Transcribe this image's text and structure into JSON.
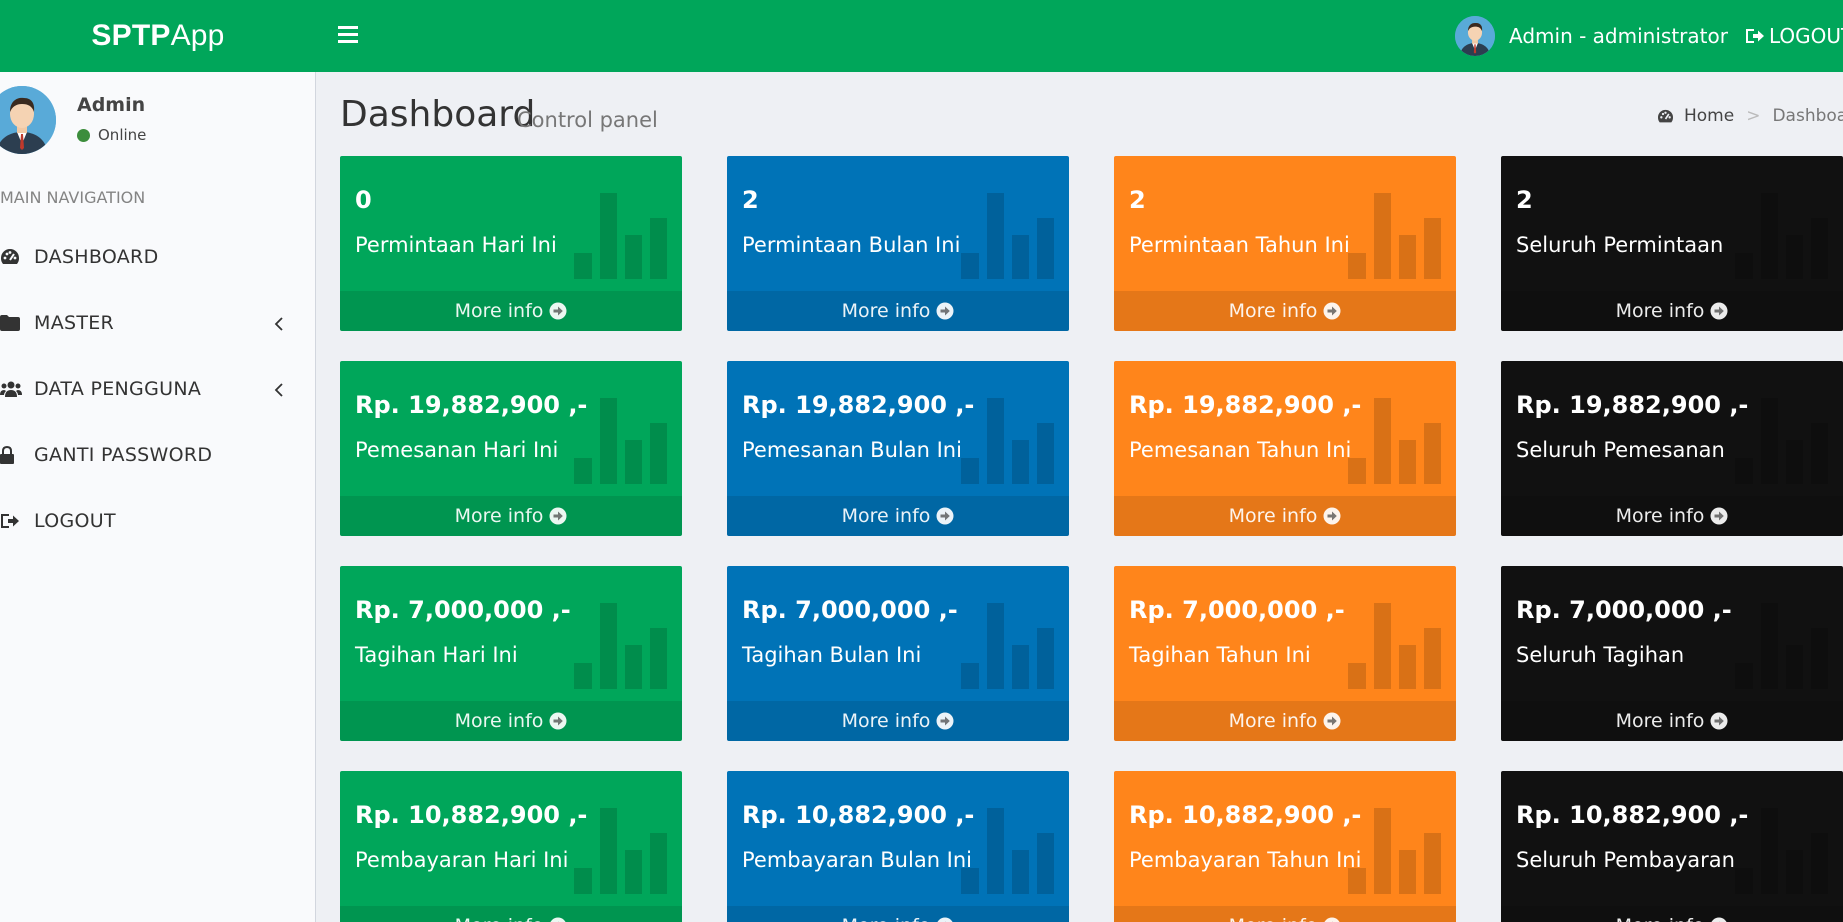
{
  "header": {
    "logo_bold": "SPTP",
    "logo_light": "App",
    "user_label": "Admin - administrator",
    "logout_label": "LOGOUT"
  },
  "sidebar": {
    "user_name": "Admin",
    "user_status": "Online",
    "nav_header": "MAIN NAVIGATION",
    "items": [
      {
        "label": "DASHBOARD",
        "icon": "dashboard-icon"
      },
      {
        "label": "MASTER",
        "icon": "folder-icon",
        "has_submenu": true
      },
      {
        "label": "DATA PENGGUNA",
        "icon": "users-icon",
        "has_submenu": true
      },
      {
        "label": "GANTI PASSWORD",
        "icon": "lock-icon"
      },
      {
        "label": "LOGOUT",
        "icon": "sign-out-icon"
      }
    ]
  },
  "content_header": {
    "title": "Dashboard",
    "subtitle": "Control panel",
    "breadcrumb_home": "Home",
    "breadcrumb_active": "Dashboard"
  },
  "colors": {
    "green": "#00a65a",
    "blue": "#0073b7",
    "orange": "#ff851b",
    "black": "#111111"
  },
  "more_info_label": "More info",
  "boxes": [
    [
      {
        "value": "0",
        "label": "Permintaan Hari Ini",
        "color": "green"
      },
      {
        "value": "2",
        "label": "Permintaan Bulan Ini",
        "color": "blue"
      },
      {
        "value": "2",
        "label": "Permintaan Tahun Ini",
        "color": "orange"
      },
      {
        "value": "2",
        "label": "Seluruh Permintaan",
        "color": "black"
      }
    ],
    [
      {
        "value": "Rp. 19,882,900 ,-",
        "label": "Pemesanan Hari Ini",
        "color": "green"
      },
      {
        "value": "Rp. 19,882,900 ,-",
        "label": "Pemesanan Bulan Ini",
        "color": "blue"
      },
      {
        "value": "Rp. 19,882,900 ,-",
        "label": "Pemesanan Tahun Ini",
        "color": "orange"
      },
      {
        "value": "Rp. 19,882,900 ,-",
        "label": "Seluruh Pemesanan",
        "color": "black"
      }
    ],
    [
      {
        "value": "Rp. 7,000,000 ,-",
        "label": "Tagihan Hari Ini",
        "color": "green"
      },
      {
        "value": "Rp. 7,000,000 ,-",
        "label": "Tagihan Bulan Ini",
        "color": "blue"
      },
      {
        "value": "Rp. 7,000,000 ,-",
        "label": "Tagihan Tahun Ini",
        "color": "orange"
      },
      {
        "value": "Rp. 7,000,000 ,-",
        "label": "Seluruh Tagihan",
        "color": "black"
      }
    ],
    [
      {
        "value": "Rp. 10,882,900 ,-",
        "label": "Pembayaran Hari Ini",
        "color": "green"
      },
      {
        "value": "Rp. 10,882,900 ,-",
        "label": "Pembayaran Bulan Ini",
        "color": "blue"
      },
      {
        "value": "Rp. 10,882,900 ,-",
        "label": "Pembayaran Tahun Ini",
        "color": "orange"
      },
      {
        "value": "Rp. 10,882,900 ,-",
        "label": "Seluruh Pembayaran",
        "color": "black"
      }
    ]
  ]
}
